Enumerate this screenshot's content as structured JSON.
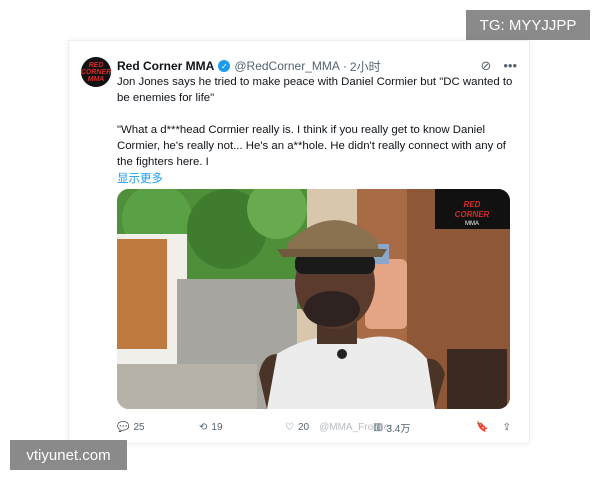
{
  "watermark_top": "TG: MYYJJPP",
  "watermark_bottom": "vtiyunet.com",
  "tweet": {
    "display_name": "Red Corner MMA",
    "handle": "@RedCorner_MMA",
    "time": "2小时",
    "text_line1": "Jon Jones says he tried to make peace with Daniel Cormier but \"DC wanted to be enemies for life\"",
    "text_para2": "\"What a d***head Cormier really is. I think if you really get to know Daniel Cormier, he's really not... He's an a**hole. He didn't really connect with any of the fighters here. I",
    "show_more": "显示更多",
    "media_logo": "RED CORNER MMA",
    "avatar_logo": "RED CORNER MMA",
    "stats": {
      "replies": "25",
      "retweets": "19",
      "likes": "20",
      "views": "3.4万"
    },
    "overlay_watermark": "@MMA_Frontier"
  },
  "colors": {
    "accent": "#1d9bf0",
    "text": "#0f1419",
    "muted": "#536471",
    "badge": "#8a8a8a"
  }
}
